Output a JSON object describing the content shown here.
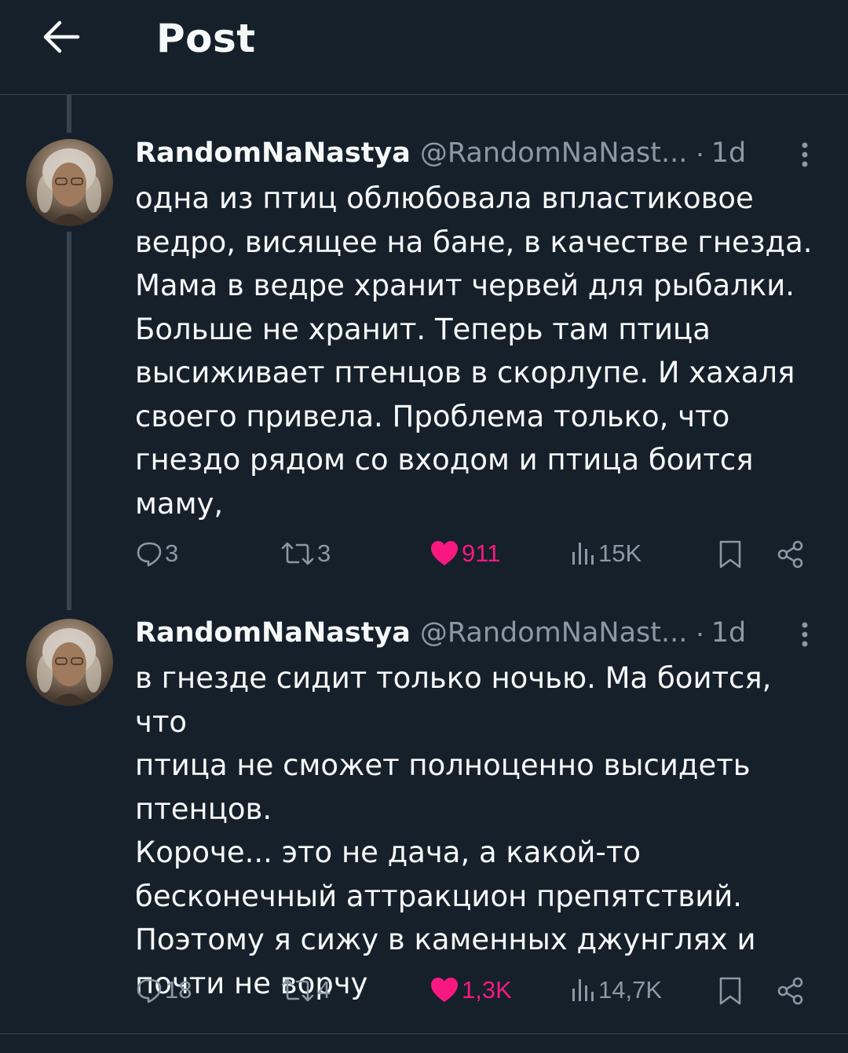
{
  "header": {
    "title": "Post",
    "back_icon": "arrow-left-icon"
  },
  "colors": {
    "background": "#15202b",
    "text": "#f7f9f9",
    "muted": "#8b98a5",
    "like": "#f91880",
    "border": "#38444d"
  },
  "tweets": [
    {
      "name": "RandomNaNastya",
      "handle": "@RandomNaNast...",
      "dot": "·",
      "time": "1d",
      "text": "одна из птиц облюбовала впластиковое\nведро, висящее на бане, в качестве гнезда.\nМама в ведре хранит червей для рыбалки.\nБольше не хранит. Теперь там птица\nвысиживает птенцов в скорлупе. И хахаля\nсвоего привела. Проблема только, что\nгнездо рядом со входом и птица боится\nмаму,",
      "replies": "3",
      "retweets": "3",
      "likes": "911",
      "views": "15K",
      "liked": true
    },
    {
      "name": "RandomNaNastya",
      "handle": "@RandomNaNast...",
      "dot": "·",
      "time": "1d",
      "text": "в гнезде сидит только ночью. Ма боится, что\nптица не сможет полноценно высидеть\nптенцов.\nКороче... это не дача, а какой-то\nбесконечный аттракцион препятствий.\nПоэтому я сижу в каменных джунглях и\nпочти не ворчу",
      "replies": "18",
      "retweets": "4",
      "likes": "1,3K",
      "views": "14,7K",
      "liked": true
    }
  ]
}
